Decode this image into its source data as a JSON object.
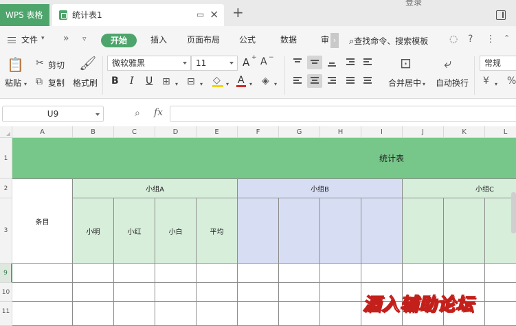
{
  "titlebar": {
    "app_tab": "WPS 表格",
    "doc_tab": "统计表1",
    "login_stub": "登录"
  },
  "menu": {
    "file": "文件",
    "items": [
      "开始",
      "插入",
      "页面布局",
      "公式",
      "数据",
      "审"
    ],
    "active_index": 0,
    "search": "查找命令、搜索模板"
  },
  "ribbon": {
    "paste": "粘贴",
    "cut": "剪切",
    "copy": "复制",
    "format_painter": "格式刷",
    "font_name": "微软雅黑",
    "font_size": "11",
    "merge_center": "合并居中",
    "wrap_text": "自动换行",
    "number_format": "常规",
    "bold": "B",
    "italic": "I",
    "underline": "U",
    "grow_font": "A",
    "shrink_font": "A"
  },
  "formula_bar": {
    "name_box": "U9",
    "fx": "fx",
    "formula": ""
  },
  "grid": {
    "columns": [
      "A",
      "B",
      "C",
      "D",
      "E",
      "F",
      "G",
      "H",
      "I",
      "J",
      "K",
      "L"
    ],
    "rows": [
      "1",
      "2",
      "3",
      "9",
      "10",
      "11"
    ],
    "selected_row": "9",
    "title": "统计表",
    "item_header": "条目",
    "groups": [
      "小组A",
      "小组B",
      "小组C"
    ],
    "group_a_members": [
      "小明",
      "小红",
      "小白",
      "平均"
    ]
  },
  "colors": {
    "brand_green": "#4ea56c",
    "header_green": "#78c78a",
    "group_a_fill": "#d7eedb",
    "group_b_fill": "#d7def3",
    "group_c_fill": "#d7eedb",
    "watermark_red": "#c4201b"
  },
  "watermark": "酒入辅助论坛"
}
